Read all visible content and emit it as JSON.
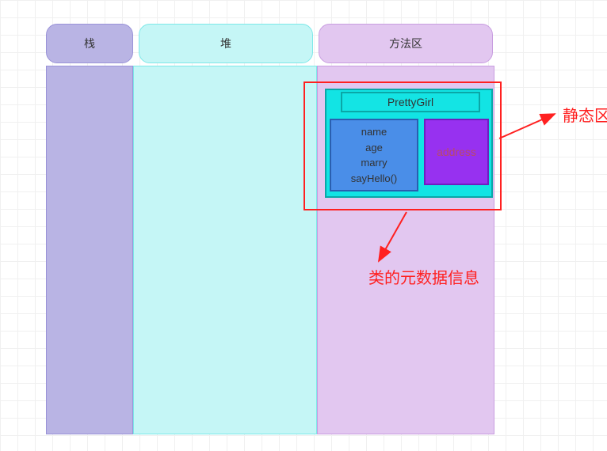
{
  "columns": {
    "stack_label": "栈",
    "heap_label": "堆",
    "methodarea_label": "方法区"
  },
  "class_info": {
    "name": "PrettyGirl",
    "instance_members": "name\nage\nmarry\nsayHello()",
    "static_member": "address"
  },
  "annotations": {
    "static_area": "静态区",
    "metadata": "类的元数据信息"
  },
  "colors": {
    "stack_fill": "#b9b4e4",
    "heap_fill": "#c5f6f6",
    "methodarea_fill": "#e2c7f0",
    "cyan": "#12e4e4",
    "blue": "#4a8ee8",
    "purple": "#9731f0",
    "annotation": "#ff2020"
  }
}
